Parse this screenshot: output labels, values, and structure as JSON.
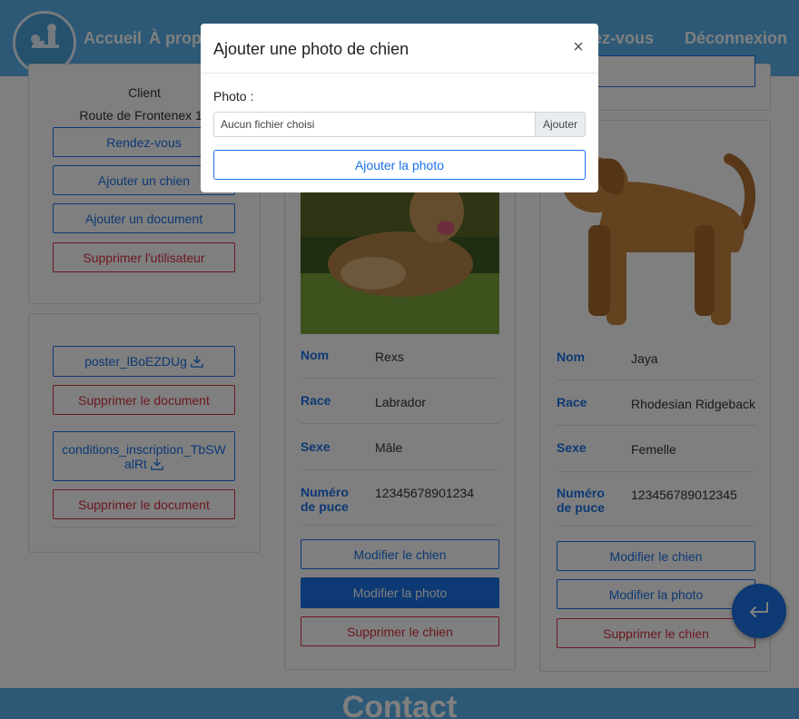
{
  "nav": {
    "links": [
      "Accueil",
      "À propos",
      "Rendez-vous",
      "Déconnexion"
    ]
  },
  "user_card": {
    "role": "Client",
    "address": "Route de Frontenex 10",
    "buttons": {
      "appointments": "Rendez-vous",
      "add_dog": "Ajouter un chien",
      "add_document": "Ajouter un document",
      "delete_user": "Supprimer l'utilisateur"
    }
  },
  "documents": {
    "items": [
      {
        "name": "poster_lBoEZDUg",
        "delete_label": "Supprimer le document"
      },
      {
        "name": "conditions_inscription_TbSWalRt",
        "delete_label": "Supprimer le document"
      }
    ]
  },
  "labels": {
    "name": "Nom",
    "breed": "Race",
    "sex": "Sexe",
    "chip_line1": "Numéro",
    "chip_line2": "de puce"
  },
  "dogs": [
    {
      "name": "Rexs",
      "breed": "Labrador",
      "sex": "Mâle",
      "chip": "12345678901234",
      "edit_label": "Modifier le chien",
      "photo_label": "Modifier la photo",
      "delete_label": "Supprimer le chien"
    },
    {
      "name": "Jaya",
      "breed": "Rhodesian Ridgeback",
      "sex": "Femelle",
      "chip": "123456789012345",
      "edit_label": "Modifier le chien",
      "photo_label": "Modifier la photo",
      "delete_label": "Supprimer le chien"
    }
  ],
  "footer": {
    "title": "Contact"
  },
  "modal": {
    "title": "Ajouter une photo de chien",
    "close": "×",
    "field_label": "Photo :",
    "file_placeholder": "Aucun fichier choisi",
    "file_button": "Ajouter",
    "submit": "Ajouter la photo"
  },
  "colors": {
    "primary": "#1a73e8",
    "danger": "#d93040",
    "navbar": "#5ab3ec"
  }
}
